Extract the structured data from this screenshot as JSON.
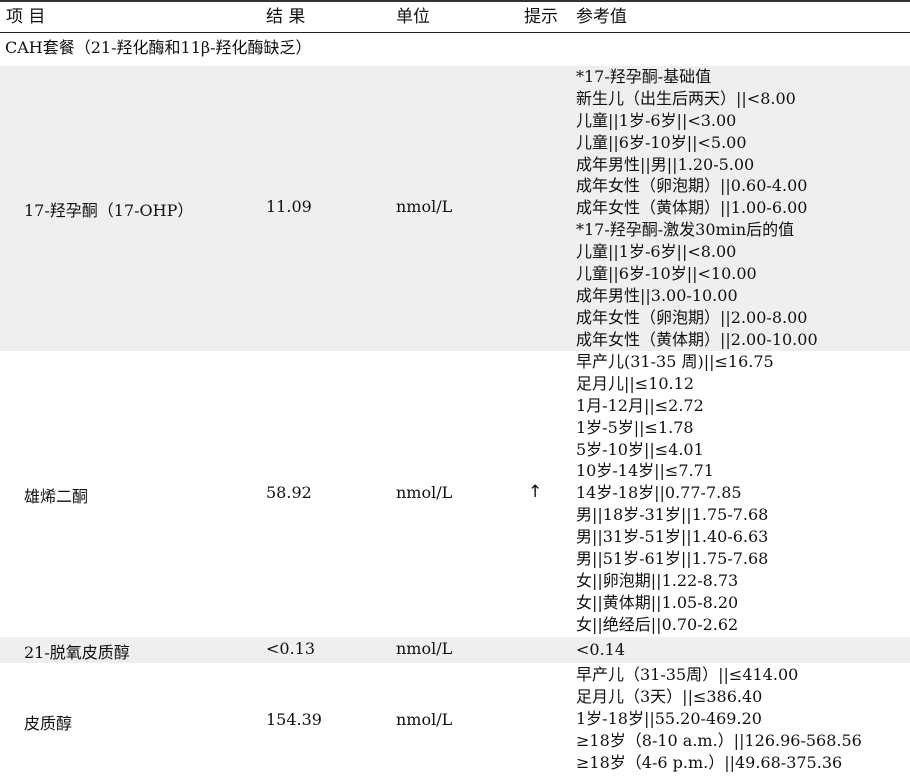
{
  "header": {
    "col_item": "项  目",
    "col_result": "结  果",
    "col_unit": "单位",
    "col_flag": "提示",
    "col_ref": "参考值"
  },
  "section": {
    "title": "CAH套餐（21-羟化酶和11β-羟化酶缺乏）"
  },
  "rows": [
    {
      "item": "17-羟孕酮（17-OHP）",
      "result": "11.09",
      "unit": "nmol/L",
      "flag": "",
      "refs": [
        "*17-羟孕酮-基础值",
        "新生儿（出生后两天）||<8.00",
        "儿童||1岁-6岁||<3.00",
        "儿童||6岁-10岁||<5.00",
        "成年男性||男||1.20-5.00",
        "成年女性（卵泡期）||0.60-4.00",
        "成年女性（黄体期）||1.00-6.00",
        "*17-羟孕酮-激发30min后的值",
        "儿童||1岁-6岁||<8.00",
        "儿童||6岁-10岁||<10.00",
        "成年男性||3.00-10.00",
        "成年女性（卵泡期）||2.00-8.00",
        "成年女性（黄体期）||2.00-10.00"
      ]
    },
    {
      "item": "雄烯二酮",
      "result": "58.92",
      "unit": "nmol/L",
      "flag": "↑",
      "refs": [
        "早产儿(31-35 周)||≤16.75",
        "足月儿||≤10.12",
        "1月-12月||≤2.72",
        "1岁-5岁||≤1.78",
        "5岁-10岁||≤4.01",
        "10岁-14岁||≤7.71",
        "14岁-18岁||0.77-7.85",
        "男||18岁-31岁||1.75-7.68",
        "男||31岁-51岁||1.40-6.63",
        "男||51岁-61岁||1.75-7.68",
        "女||卵泡期||1.22-8.73",
        "女||黄体期||1.05-8.20",
        "女||绝经后||0.70-2.62"
      ]
    },
    {
      "item": "21-脱氧皮质醇",
      "result": "<0.13",
      "unit": "nmol/L",
      "flag": "",
      "refs": [
        "<0.14"
      ]
    },
    {
      "item": "皮质醇",
      "result": "154.39",
      "unit": "nmol/L",
      "flag": "",
      "refs": [
        "早产儿（31-35周）||≤414.00",
        "足月儿（3天）||≤386.40",
        "1岁-18岁||55.20-469.20",
        "≥18岁（8-10 a.m.）||126.96-568.56",
        "≥18岁（4-6 p.m.）||49.68-375.36"
      ]
    }
  ]
}
